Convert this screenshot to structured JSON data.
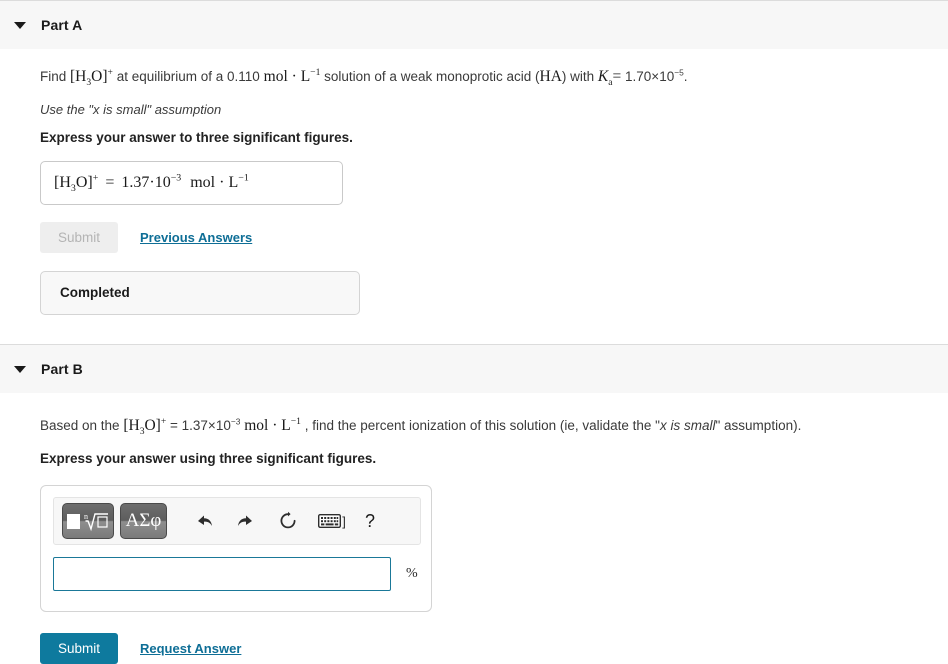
{
  "parts": [
    {
      "id": "part-a",
      "title": "Part A",
      "disclosure_icon": "caret-down-icon",
      "prompt": {
        "text_1": "Find ",
        "formula_1": "[H3O]+",
        "text_2": " at equilibrium of a ",
        "value_1": "0.110",
        "formula_2": "mol · L−1",
        "text_3": " solution of a weak monoprotic acid (",
        "formula_3": "HA",
        "text_4": ") with ",
        "formula_4": "Ka",
        "equals": "=",
        "value_2": "1.70×10−5",
        "text_5": "."
      },
      "hint": "Use the \"x is small\" assumption",
      "express": "Express your answer to three significant figures.",
      "answer_display": {
        "variable": "[H3O]+",
        "equals": "=",
        "value": "1.37·10−3",
        "units": "mol · L−1"
      },
      "submit_label": "Submit",
      "submit_enabled": false,
      "secondary_link": "Previous Answers",
      "status": "Completed"
    },
    {
      "id": "part-b",
      "title": "Part B",
      "disclosure_icon": "caret-down-icon",
      "prompt": {
        "text_1": "Based on the ",
        "formula_1": "[H3O]+",
        "equals": "=",
        "value_1": "1.37×10−3",
        "formula_2": "mol · L−1",
        "text_2": ", find the percent ionization of this solution (ie, validate the \"",
        "italic_1": "x is small",
        "text_3": "\" assumption)."
      },
      "express": "Express your answer using three significant figures.",
      "toolbar": {
        "template_button": "math-template",
        "greek_button": "ΑΣφ",
        "undo": "undo-icon",
        "redo": "redo-icon",
        "reset": "reset-icon",
        "keyboard": "keyboard-icon",
        "keyboard_bracket": "]",
        "help": "?"
      },
      "input_value": "",
      "input_placeholder": "",
      "unit_suffix": "%",
      "submit_label": "Submit",
      "submit_enabled": true,
      "secondary_link": "Request Answer"
    }
  ],
  "colors": {
    "accent": "#0e7a9e",
    "link": "#0e6e96",
    "header_bg": "#f7f7f7",
    "input_border": "#1a7898",
    "disabled_btn": "#eeeeee"
  }
}
